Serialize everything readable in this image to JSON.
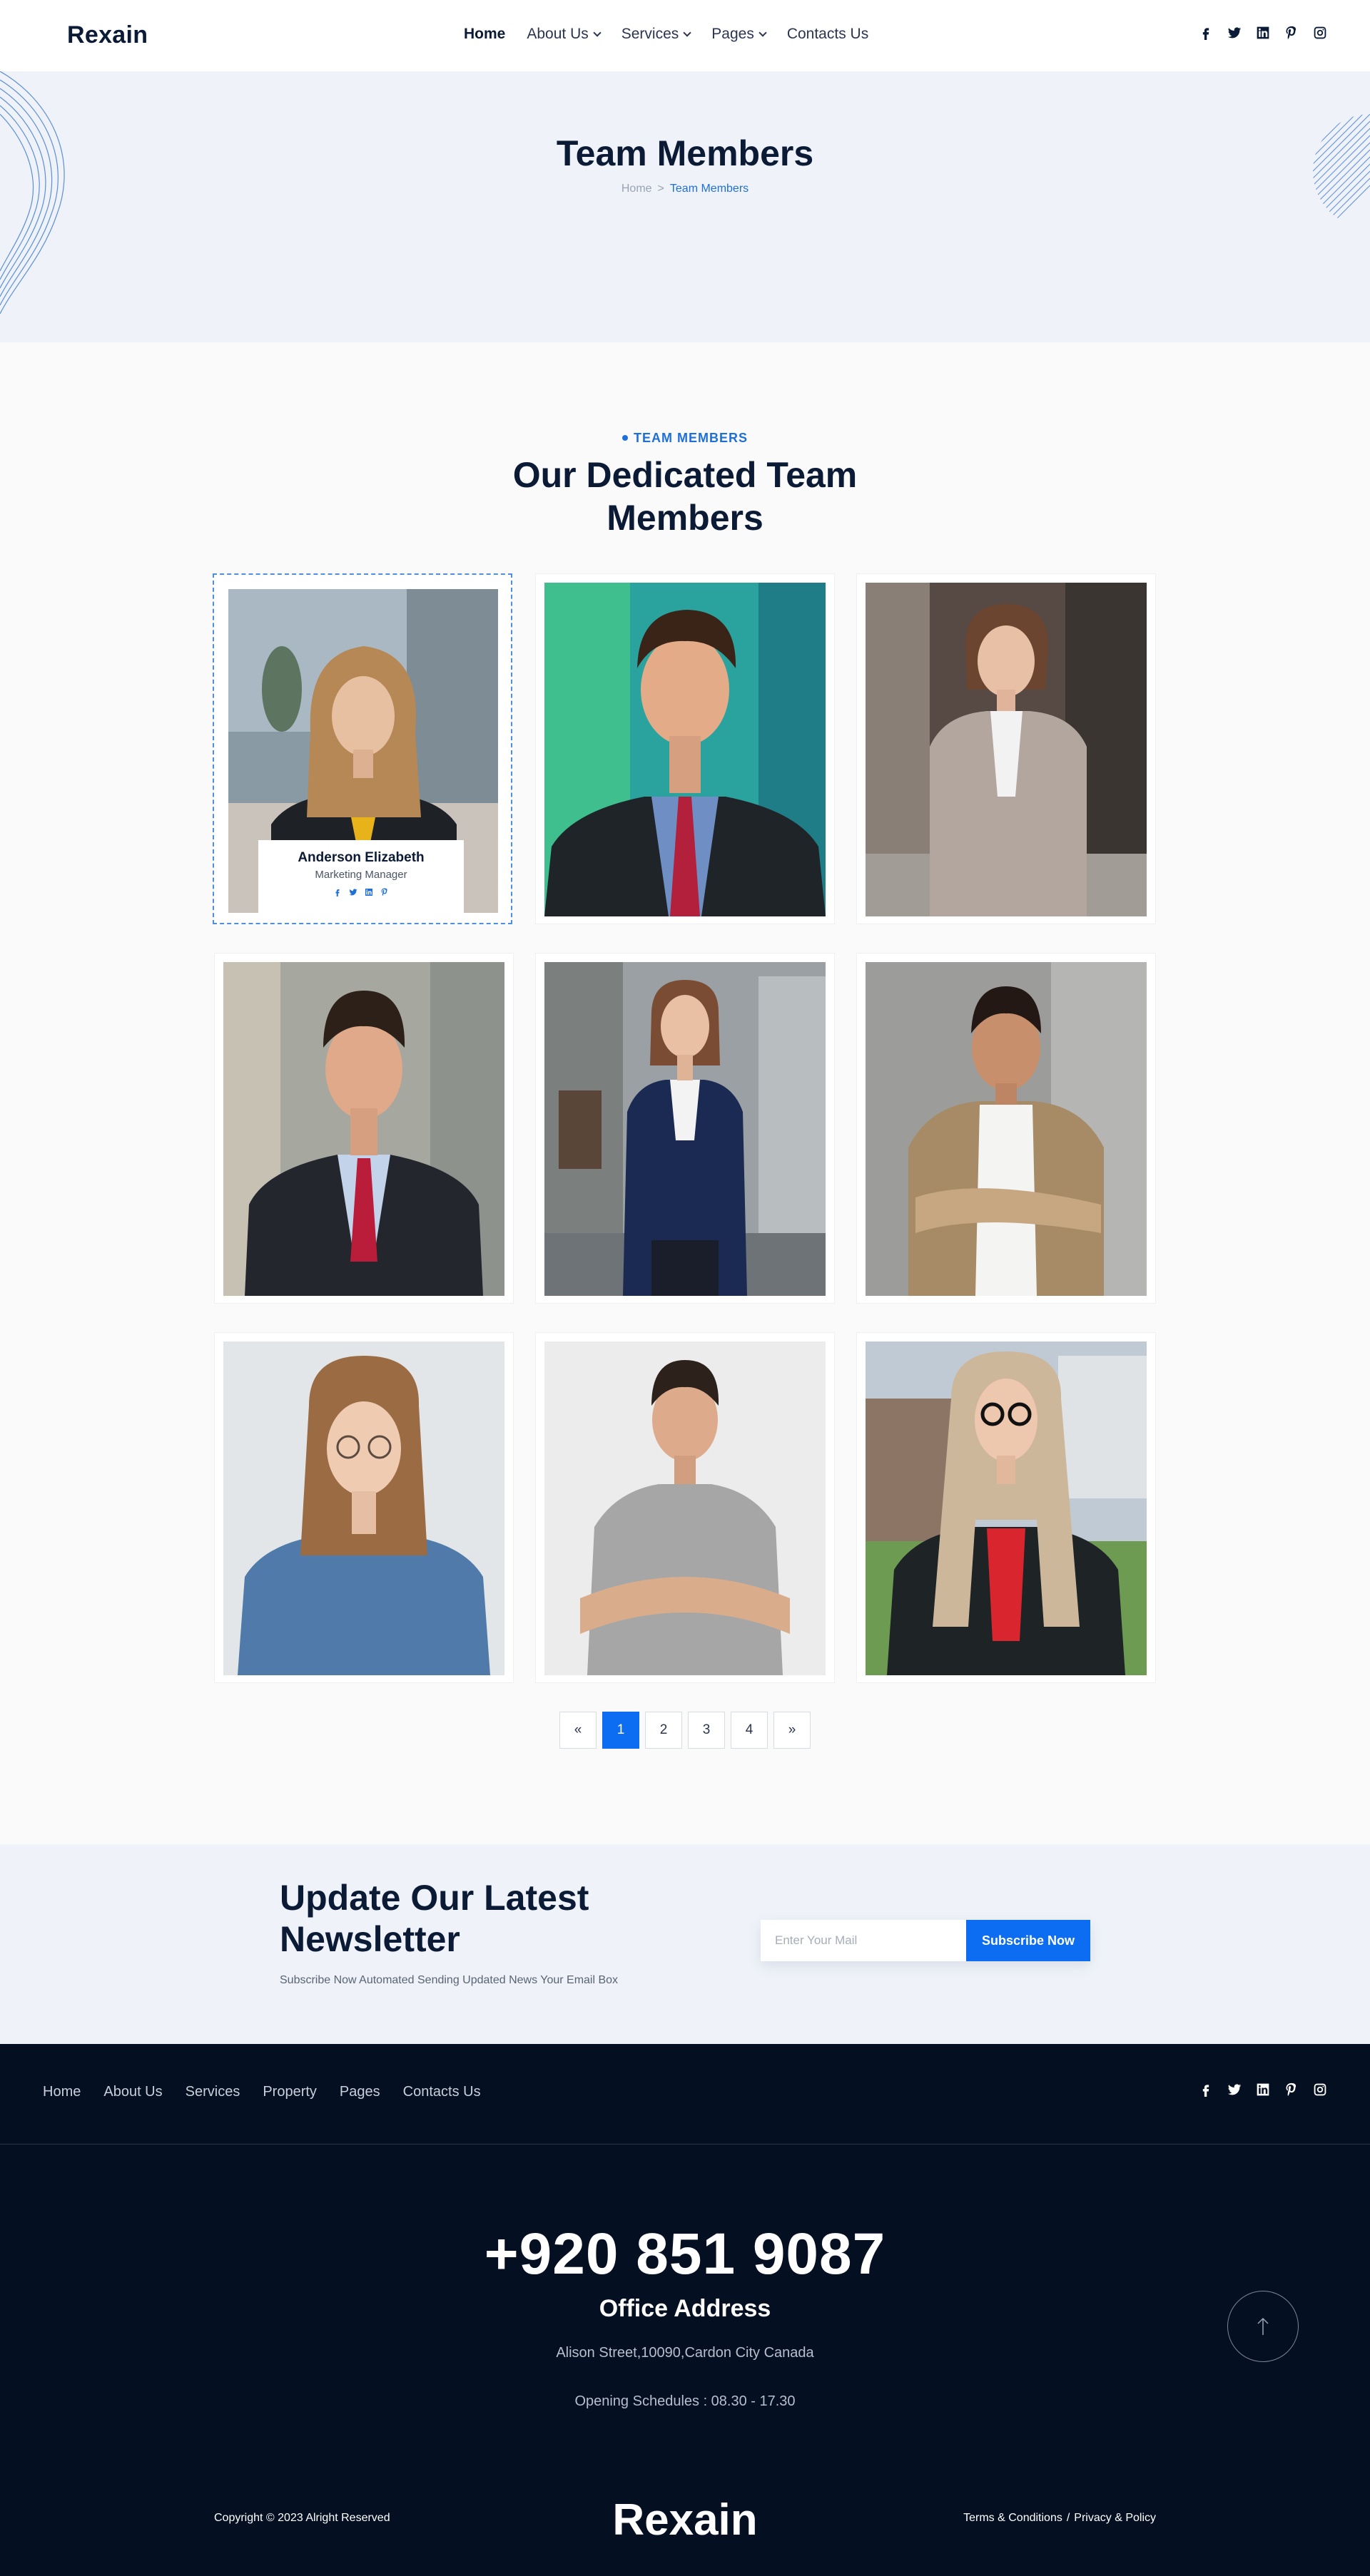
{
  "header": {
    "logo": "Rexain",
    "nav": [
      {
        "label": "Home"
      },
      {
        "label": "About Us"
      },
      {
        "label": "Services"
      },
      {
        "label": "Pages"
      },
      {
        "label": "Contacts Us"
      }
    ],
    "social_icons": [
      "facebook-icon",
      "twitter-icon",
      "linkedin-icon",
      "pinterest-icon",
      "instagram-icon"
    ]
  },
  "hero": {
    "title": "Team Members",
    "breadcrumb": {
      "home": "Home",
      "separator": ">",
      "current": "Team Members"
    }
  },
  "team": {
    "eyebrow": "TEAM MEMBERS",
    "heading": "Our Dedicated Team Members",
    "featured_member": {
      "name": "Anderson Elizabeth",
      "role": "Marketing Manager"
    },
    "pagination": {
      "prev": "«",
      "pages": [
        "1",
        "2",
        "3",
        "4"
      ],
      "active_page": "1",
      "next": "»"
    }
  },
  "newsletter": {
    "title": "Update Our Latest Newsletter",
    "subtitle": "Subscribe Now Automated Sending Updated News Your Email Box",
    "input_placeholder": "Enter Your Mail",
    "button": "Subscribe Now"
  },
  "footer": {
    "nav": [
      "Home",
      "About Us",
      "Services",
      "Property",
      "Pages",
      "Contacts Us"
    ],
    "phone": "+920 851 9087",
    "office_title": "Office Address",
    "address": "Alison Street,10090,Cardon City Canada",
    "hours": "Opening Schedules : 08.30 - 17.30",
    "copyright": "Copyright © 2023 Alright Reserved",
    "logo": "Rexain",
    "terms": "Terms & Conditions",
    "legal_separator": "/",
    "privacy": "Privacy & Policy"
  },
  "colors": {
    "primary": "#0d6df2",
    "dark_navy": "#0b1b35",
    "footer_bg": "#050f22",
    "hero_bg": "#eff3f9"
  }
}
